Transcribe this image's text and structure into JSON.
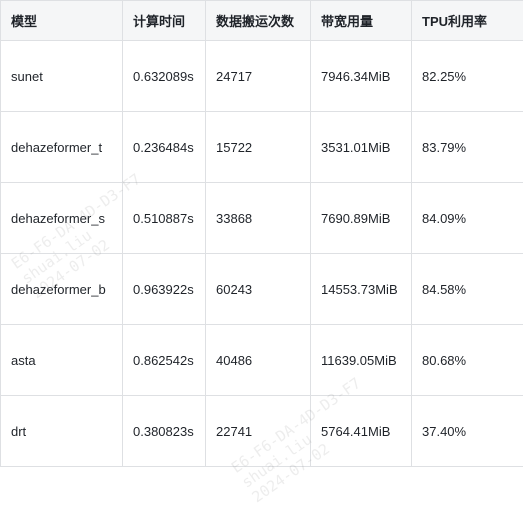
{
  "table": {
    "headers": [
      "模型",
      "计算时间",
      "数据搬运次数",
      "带宽用量",
      "TPU利用率"
    ],
    "rows": [
      [
        "sunet",
        "0.632089s",
        "24717",
        "7946.34MiB",
        "82.25%"
      ],
      [
        "dehazeformer_t",
        "0.236484s",
        "15722",
        "3531.01MiB",
        "83.79%"
      ],
      [
        "dehazeformer_s",
        "0.510887s",
        "33868",
        "7690.89MiB",
        "84.09%"
      ],
      [
        "dehazeformer_b",
        "0.963922s",
        "60243",
        "14553.73MiB",
        "84.58%"
      ],
      [
        "asta",
        "0.862542s",
        "40486",
        "11639.05MiB",
        "80.68%"
      ],
      [
        "drt",
        "0.380823s",
        "22741",
        "5764.41MiB",
        "37.40%"
      ]
    ]
  },
  "watermark": {
    "line1": "E6-F6-DA-4D-D3-F7",
    "line2": "shuai.liu",
    "line3": "2024-07-02"
  }
}
